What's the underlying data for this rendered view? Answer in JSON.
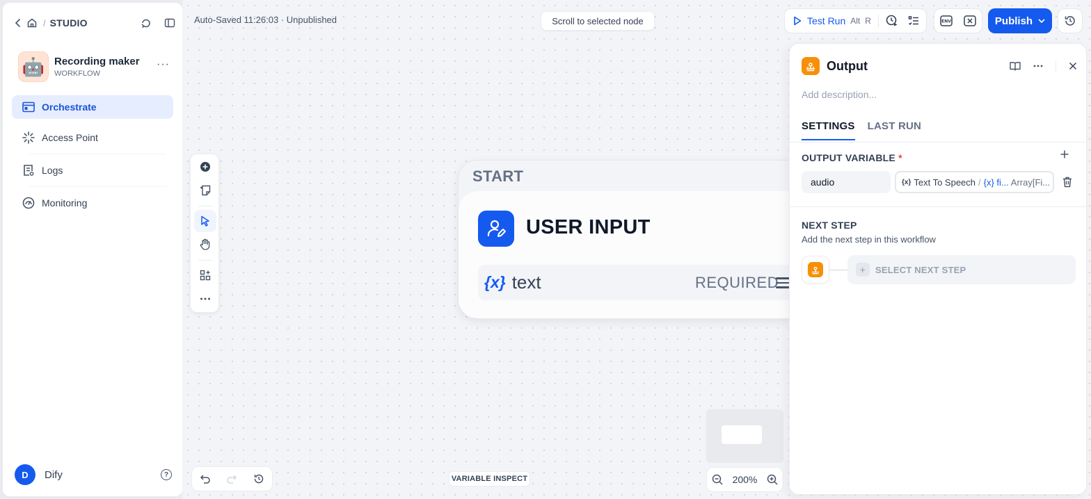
{
  "breadcrumb": {
    "section": "STUDIO"
  },
  "app": {
    "icon": "🤖",
    "name": "Recording maker",
    "type": "WORKFLOW",
    "more": "···"
  },
  "nav": [
    {
      "label": "Orchestrate",
      "icon": "layout-icon",
      "active": true
    },
    {
      "label": "Access Point",
      "icon": "access-point-icon",
      "active": false
    },
    {
      "label": "Logs",
      "icon": "logs-icon",
      "active": false
    },
    {
      "label": "Monitoring",
      "icon": "monitoring-icon",
      "active": false
    }
  ],
  "user": {
    "initial": "D",
    "name": "Dify",
    "help": "?"
  },
  "header": {
    "autosave": "Auto-Saved 11:26:03 · Unpublished",
    "scroll_to_selected": "Scroll to selected node",
    "test_run": "Test Run",
    "shortcut_1": "Alt",
    "shortcut_2": "R",
    "publish": "Publish"
  },
  "start_node": {
    "header": "START",
    "title": "USER INPUT",
    "variable_symbol": "{x}",
    "variable_name": "text",
    "variable_required": "REQUIRED"
  },
  "zoom": {
    "level": "200%"
  },
  "variable_inspect": "VARIABLE INSPECT",
  "panel": {
    "title": "Output",
    "description_placeholder": "Add description...",
    "tabs": [
      "SETTINGS",
      "LAST RUN"
    ],
    "output_variable_title": "OUTPUT VARIABLE",
    "required_mark": "*",
    "output_var": {
      "name": "audio",
      "source_symbol": "{x}",
      "source_node": "Text To Speech",
      "separator": "/",
      "source_var": "{x} fi...",
      "source_type": "Array[Fi..."
    },
    "next_step_title": "NEXT STEP",
    "next_step_subtitle": "Add the next step in this workflow",
    "select_next_step": "SELECT NEXT STEP"
  },
  "colors": {
    "accent": "#155aef",
    "output_node": "#f79009",
    "active_nav_bg": "#e6edfe"
  }
}
